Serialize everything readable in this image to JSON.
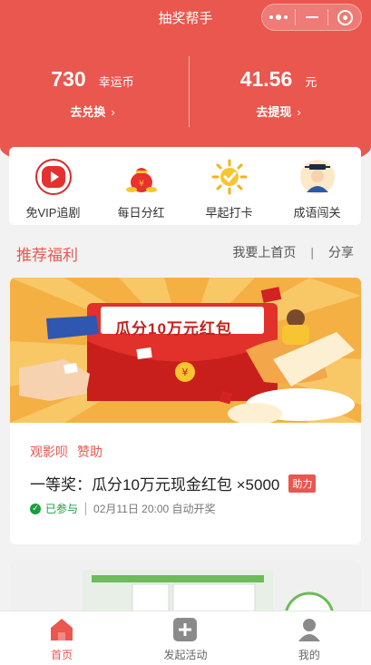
{
  "window": {
    "title": "抽奖帮手"
  },
  "stats": {
    "coins": {
      "value": "730",
      "unit": "幸运币",
      "link": "去兑换"
    },
    "cash": {
      "value": "41.56",
      "unit": "元",
      "link": "去提现"
    }
  },
  "shortcuts": [
    {
      "label": "免VIP追剧",
      "icon": "video-play-icon"
    },
    {
      "label": "每日分红",
      "icon": "money-bag-icon"
    },
    {
      "label": "早起打卡",
      "icon": "sun-check-icon"
    },
    {
      "label": "成语闯关",
      "icon": "scholar-avatar-icon"
    }
  ],
  "section": {
    "title": "推荐福利",
    "action_home": "我要上首页",
    "action_share": "分享"
  },
  "giveaway": {
    "banner_text": "瓜分10万元红包",
    "tags": [
      "观影呗",
      "赞助"
    ],
    "prize": "一等奖：瓜分10万元现金红包 ×5000",
    "badge": "助力",
    "status": "已参与",
    "draw_time": "02月11日 20:00 自动开奖"
  },
  "tabs": [
    {
      "label": "首页",
      "icon": "home-icon",
      "active": true
    },
    {
      "label": "发起活动",
      "icon": "add-icon",
      "active": false
    },
    {
      "label": "我的",
      "icon": "user-icon",
      "active": false
    }
  ],
  "colors": {
    "brand": "#e9574f",
    "success": "#1a9e3f"
  }
}
